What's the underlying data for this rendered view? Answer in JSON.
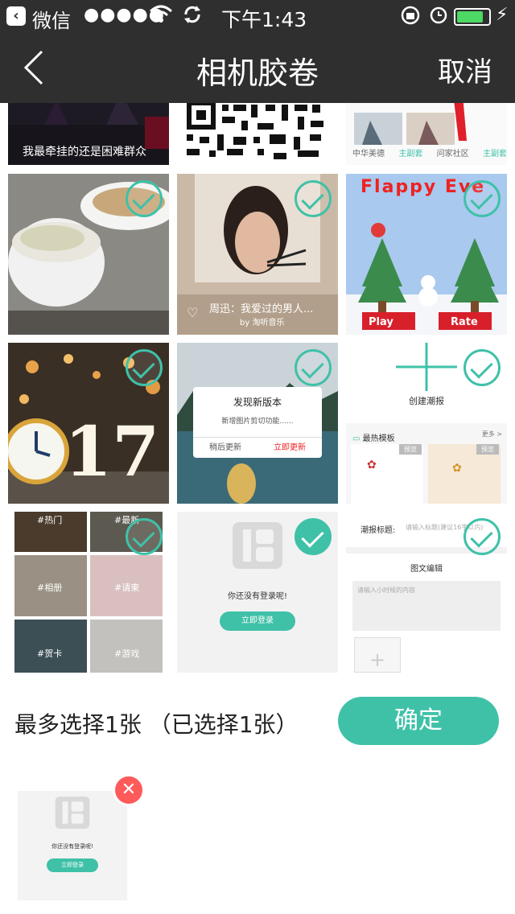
{
  "status_bar": {
    "app": "微信",
    "signal": "●●●●●",
    "time": "下午1:43"
  },
  "nav": {
    "title": "相机胶卷",
    "cancel": "取消"
  },
  "photos": {
    "top_left_caption": "我最牵挂的还是困难群众",
    "top_right_labels": [
      "中华美德",
      "主副套",
      "问家社区",
      "主副套"
    ],
    "music_title": "周迅：我爱过的男人...",
    "music_source": "by 淘听音乐",
    "game_title": "Flappy Eve",
    "game_play": "Play",
    "game_rate": "Rate",
    "update_title": "发现新版本",
    "update_desc": "新增图片剪切功能......",
    "update_later": "稍后更新",
    "update_now": "立即更新",
    "create_label": "创建潮报",
    "template_label": "最热模板",
    "template_more": "更多 >",
    "template_preview1": "预览",
    "template_preview2": "预览",
    "collage_tags": [
      "#热门",
      "#最新",
      "#相册",
      "#请柬",
      "#贺卡",
      "#游戏"
    ],
    "login_text": "你还没有登录呢!",
    "login_button": "立即登录",
    "form_label": "潮报标题:",
    "form_placeholder": "请输入标题(建议16字以内)",
    "form_section": "图文编辑",
    "form_textarea": "请输入小时候的内容"
  },
  "footer": {
    "limit_text": "最多选择1张 （已选择1张）",
    "confirm": "确定",
    "thumb_login_text": "你还没有登录呢!",
    "thumb_login_button": "立即登录"
  },
  "colors": {
    "accent": "#3fc1a8",
    "bar": "#2f2f2f",
    "remove": "#ff5a5a"
  }
}
